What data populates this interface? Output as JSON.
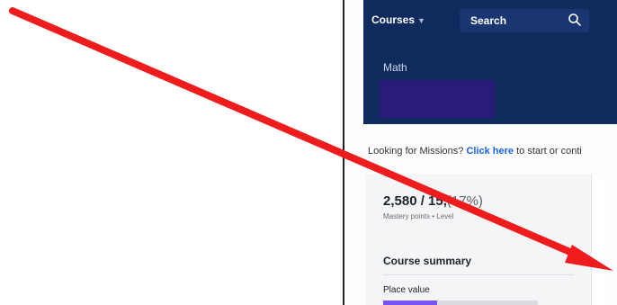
{
  "header": {
    "courses_label": "Courses",
    "search_label": "Search",
    "course_label": "Math"
  },
  "missions": {
    "prefix": "Looking for Missions? ",
    "link": "Click here",
    "suffix": " to start or conti"
  },
  "stats": {
    "points_main": "2,580 / 15,",
    "points_pct": "(17%)",
    "points_sub": "Mastery points • Level"
  },
  "summary": {
    "heading": "Course summary",
    "units": [
      {
        "name": "Place value",
        "progress": 0.35
      }
    ]
  },
  "colors": {
    "header_bg": "#0f2a5c",
    "link": "#1865f2",
    "progress": "#7854f7",
    "annotation_arrow": "#ee1c1c"
  },
  "icons": [
    "search-icon",
    "chevron-down-icon",
    "annotation-arrow"
  ]
}
